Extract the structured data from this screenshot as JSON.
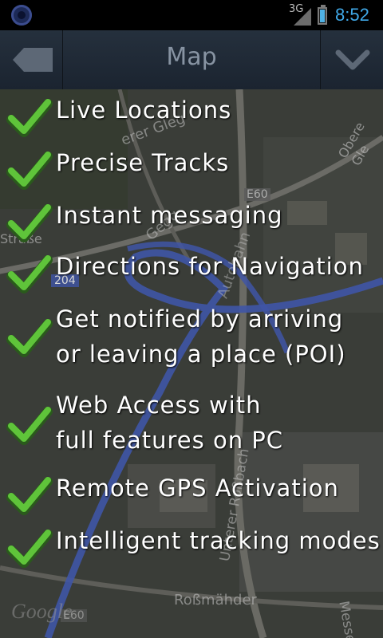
{
  "status_bar": {
    "network_type": "3G",
    "time": "8:52"
  },
  "action_bar": {
    "title": "Map",
    "back_icon": "back-arrow-icon",
    "menu_icon": "chevron-down-icon"
  },
  "map": {
    "labels": {
      "road_e60": "E60",
      "road_204": "204",
      "strasse": "Straße",
      "obere": "Obere Gle",
      "erer_gleg": "erer Gleg",
      "rossmaehder": "Roßmähder",
      "unterer": "Unterer Roßbach",
      "messestr": "Messestr",
      "autobahn": "Autobahn",
      "gegg": "Gegg",
      "google": "Google",
      "e60_bottom": "E60"
    }
  },
  "features": [
    {
      "icon": "checkmark-icon",
      "lines": [
        "Live Locations"
      ]
    },
    {
      "icon": "checkmark-icon",
      "lines": [
        "Precise Tracks"
      ]
    },
    {
      "icon": "checkmark-icon",
      "lines": [
        "Instant messaging"
      ]
    },
    {
      "icon": "checkmark-icon",
      "lines": [
        "Directions for Navigation"
      ]
    },
    {
      "icon": "checkmark-icon",
      "lines": [
        "Get notified by arriving",
        "or leaving a place (POI)"
      ]
    },
    {
      "icon": "checkmark-icon",
      "lines": [
        "Web Access with",
        "full features on PC"
      ]
    },
    {
      "icon": "checkmark-icon",
      "lines": [
        "Remote GPS Activation"
      ]
    },
    {
      "icon": "checkmark-icon",
      "lines": [
        "Intelligent tracking modes"
      ]
    }
  ]
}
